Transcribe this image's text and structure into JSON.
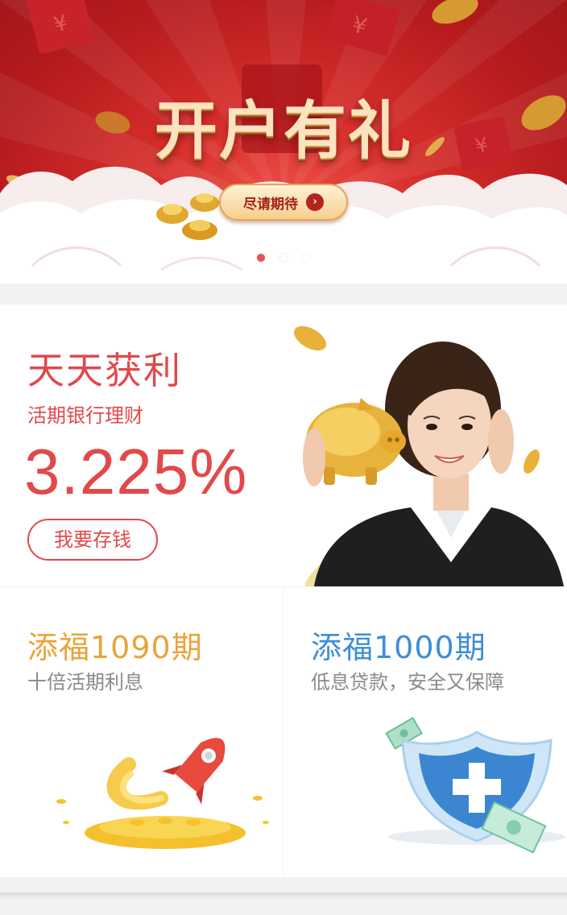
{
  "banner": {
    "title": "开户有礼",
    "button_label": "尽请期待",
    "button_icon": "chevron-right-icon",
    "slides": 3,
    "active_slide": 1,
    "colors": {
      "background": "#c8232a",
      "button": "#f6cf8e",
      "active_dot": "#e55353"
    }
  },
  "main_product": {
    "title": "天天获利",
    "subtitle": "活期银行理财",
    "rate": "3.225%",
    "button_label": "我要存钱",
    "image": "woman-with-piggy-bank",
    "color": "#e2494b"
  },
  "products": [
    {
      "title": "添福1090期",
      "subtitle": "十倍活期利息",
      "icon": "rocket-gold-coins-icon",
      "color": "#eaa43a"
    },
    {
      "title": "添福1000期",
      "subtitle": "低息贷款，安全又保障",
      "icon": "shield-cash-icon",
      "color": "#3e8ed6"
    }
  ]
}
